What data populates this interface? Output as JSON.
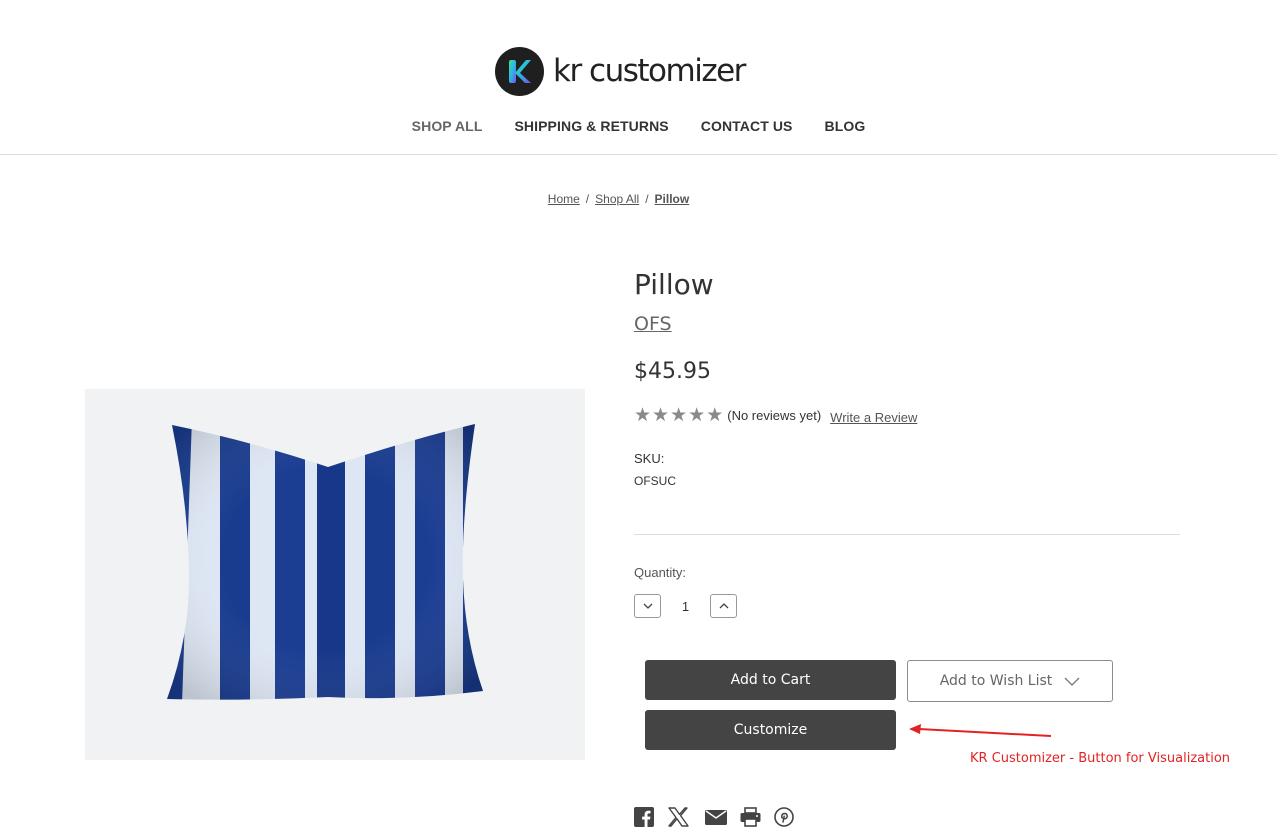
{
  "header": {
    "logo_text": "kr customizer",
    "nav": [
      {
        "label": "SHOP ALL"
      },
      {
        "label": "SHIPPING & RETURNS"
      },
      {
        "label": "CONTACT US"
      },
      {
        "label": "BLOG"
      }
    ]
  },
  "breadcrumb": {
    "items": [
      {
        "label": "Home"
      },
      {
        "label": "Shop All"
      },
      {
        "label": "Pillow"
      }
    ],
    "separator": "/"
  },
  "product": {
    "title": "Pillow",
    "brand": "OFS",
    "price": "$45.95",
    "rating": {
      "stars_filled": 0,
      "stars_total": 5,
      "reviews_text": "(No reviews yet)",
      "write_review_label": "Write a Review"
    },
    "sku_label": "SKU:",
    "sku_value": "OFSUC",
    "quantity_label": "Quantity:",
    "quantity_value": "1",
    "add_to_cart_label": "Add to Cart",
    "wishlist_label": "Add to Wish List",
    "customize_label": "Customize",
    "image_alt": "blue-white-striped-pillow"
  },
  "annotation": {
    "text": "KR Customizer - Button for Visualization",
    "color": "#e32323"
  },
  "share": {
    "icons": [
      "facebook-icon",
      "x-icon",
      "email-icon",
      "print-icon",
      "pinterest-icon"
    ]
  },
  "colors": {
    "button_dark": "#444444",
    "logo_gradient_start": "#3ee08f",
    "logo_gradient_end": "#7a4cf0"
  }
}
